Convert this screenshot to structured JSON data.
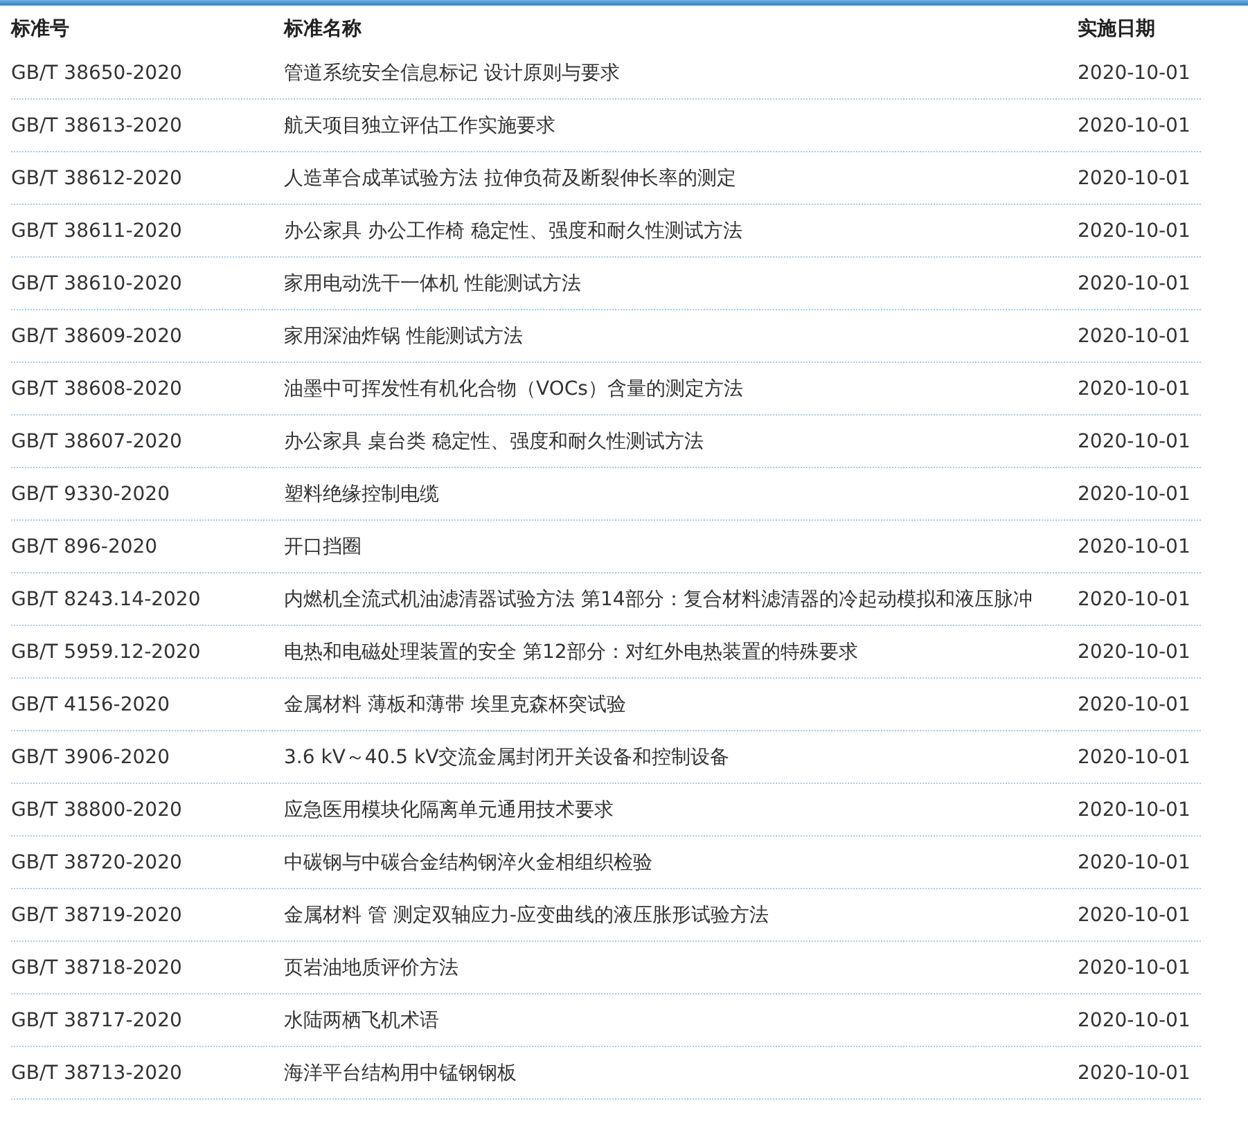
{
  "table": {
    "columns": [
      "标准号",
      "标准名称",
      "实施日期"
    ],
    "rows": [
      [
        "GB/T 38650-2020",
        "管道系统安全信息标记 设计原则与要求",
        "2020-10-01"
      ],
      [
        "GB/T 38613-2020",
        "航天项目独立评估工作实施要求",
        "2020-10-01"
      ],
      [
        "GB/T 38612-2020",
        "人造革合成革试验方法 拉伸负荷及断裂伸长率的测定",
        "2020-10-01"
      ],
      [
        "GB/T 38611-2020",
        "办公家具 办公工作椅 稳定性、强度和耐久性测试方法",
        "2020-10-01"
      ],
      [
        "GB/T 38610-2020",
        "家用电动洗干一体机 性能测试方法",
        "2020-10-01"
      ],
      [
        "GB/T 38609-2020",
        "家用深油炸锅 性能测试方法",
        "2020-10-01"
      ],
      [
        "GB/T 38608-2020",
        "油墨中可挥发性有机化合物（VOCs）含量的测定方法",
        "2020-10-01"
      ],
      [
        "GB/T 38607-2020",
        "办公家具 桌台类 稳定性、强度和耐久性测试方法",
        "2020-10-01"
      ],
      [
        "GB/T 9330-2020",
        "塑料绝缘控制电缆",
        "2020-10-01"
      ],
      [
        "GB/T 896-2020",
        "开口挡圈",
        "2020-10-01"
      ],
      [
        "GB/T 8243.14-2020",
        "内燃机全流式机油滤清器试验方法 第14部分：复合材料滤清器的冷起动模拟和液压脉冲",
        "2020-10-01"
      ],
      [
        "GB/T 5959.12-2020",
        "电热和电磁处理装置的安全 第12部分：对红外电热装置的特殊要求",
        "2020-10-01"
      ],
      [
        "GB/T 4156-2020",
        "金属材料 薄板和薄带 埃里克森杯突试验",
        "2020-10-01"
      ],
      [
        "GB/T 3906-2020",
        "3.6 kV～40.5 kV交流金属封闭开关设备和控制设备",
        "2020-10-01"
      ],
      [
        "GB/T 38800-2020",
        "应急医用模块化隔离单元通用技术要求",
        "2020-10-01"
      ],
      [
        "GB/T 38720-2020",
        "中碳钢与中碳合金结构钢淬火金相组织检验",
        "2020-10-01"
      ],
      [
        "GB/T 38719-2020",
        "金属材料 管 测定双轴应力-应变曲线的液压胀形试验方法",
        "2020-10-01"
      ],
      [
        "GB/T 38718-2020",
        "页岩油地质评价方法",
        "2020-10-01"
      ],
      [
        "GB/T 38717-2020",
        "水陆两栖飞机术语",
        "2020-10-01"
      ],
      [
        "GB/T 38713-2020",
        "海洋平台结构用中锰钢钢板",
        "2020-10-01"
      ]
    ]
  }
}
